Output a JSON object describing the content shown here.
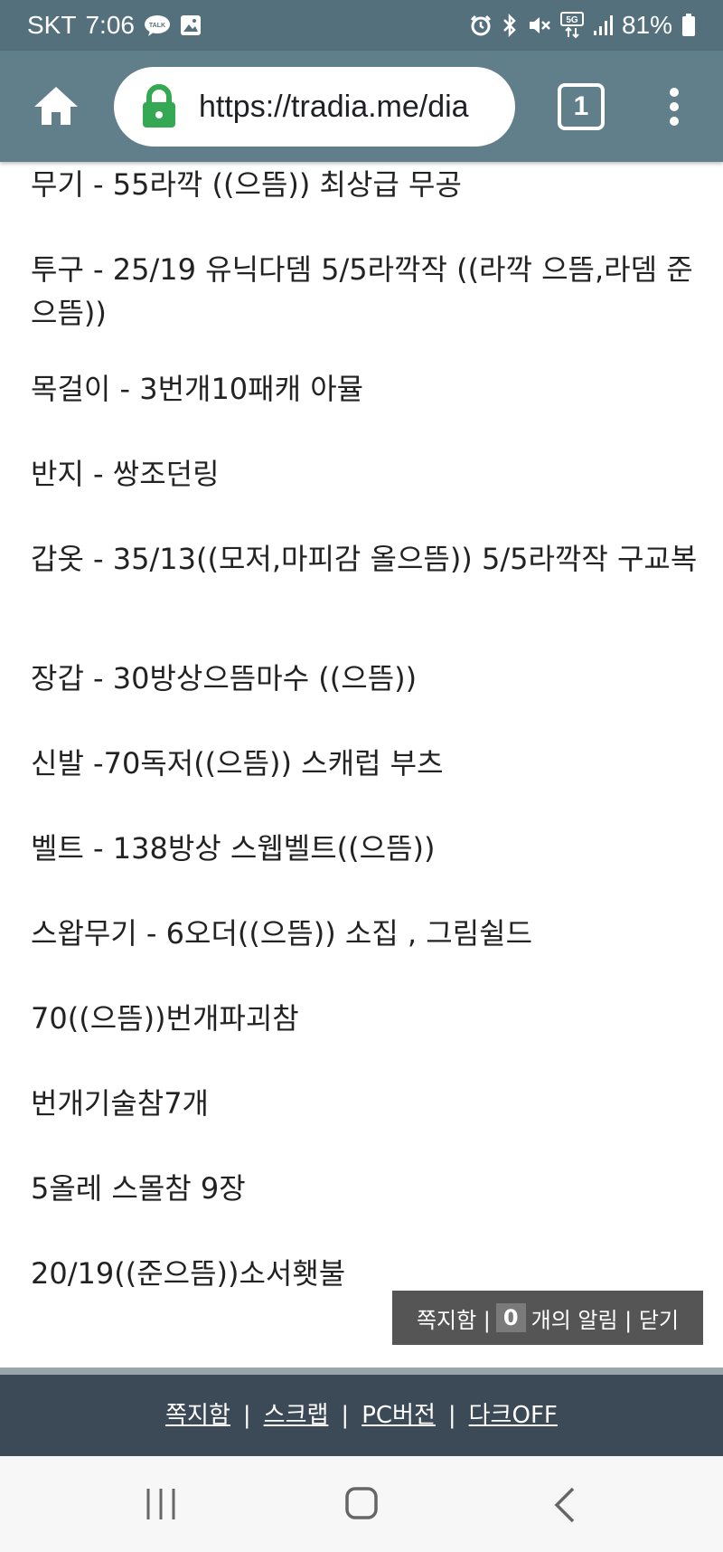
{
  "status": {
    "carrier": "SKT",
    "time": "7:06",
    "battery": "81%",
    "net": "5G"
  },
  "browser": {
    "url": "https://tradia.me/dia",
    "tab_count": "1"
  },
  "lines": [
    "무기 - 55라깍 ((으뜸)) 최상급 무공",
    "투구 - 25/19 유닉다뎀 5/5라깍작 ((라깍 으뜸,라뎀 준으뜸))",
    "목걸이 - 3번개10패캐 아뮬",
    "반지 - 쌍조던링",
    "갑옷 - 35/13((모저,마피감 올으뜸)) 5/5라깍작 구교복",
    "장갑 - 30방상으뜸마수 ((으뜸))",
    "신발 -70독저((으뜸)) 스캐럽 부츠",
    "벨트 - 138방상 스웹벨트((으뜸))",
    "스왑무기 - 6오더((으뜸)) 소집 , 그림쉴드",
    "70((으뜸))번개파괴참",
    "번개기술참7개",
    "5올레 스몰참 9장",
    "20/19((준으뜸))소서횃불"
  ],
  "notification": {
    "prefix": "쪽지함 |",
    "count": "0",
    "suffix": "개의 알림 | 닫기"
  },
  "footer": {
    "links": [
      "쪽지함",
      "스크랩",
      "PC버전",
      "다크OFF"
    ],
    "separator": "|"
  },
  "colors": {
    "status_bar": "#55707d",
    "toolbar": "#617e8b",
    "lock": "#34a853",
    "footer": "#3c4a58"
  }
}
